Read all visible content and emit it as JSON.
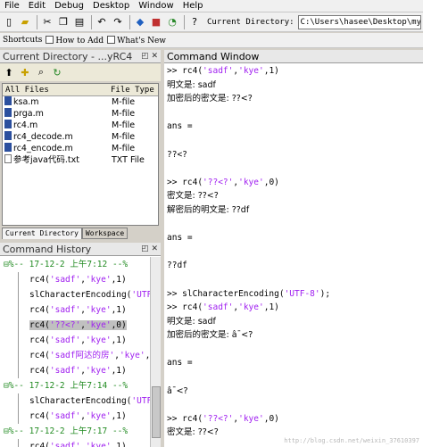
{
  "menu": [
    "File",
    "Edit",
    "Debug",
    "Desktop",
    "Window",
    "Help"
  ],
  "toolbar": {
    "current_directory_label": "Current Directory:",
    "current_directory_value": "C:\\Users\\hasee\\Desktop\\myRC4"
  },
  "shortcuts": {
    "label": "Shortcuts",
    "how_to_add": "How to Add",
    "whats_new": "What's New"
  },
  "current_directory_pane": {
    "title": "Current Directory - ...yRC4",
    "columns": [
      "All Files",
      "File Type"
    ],
    "files": [
      {
        "name": "ksa.m",
        "type": "M-file",
        "icon": "m-file-icon"
      },
      {
        "name": "prga.m",
        "type": "M-file",
        "icon": "m-file-icon"
      },
      {
        "name": "rc4.m",
        "type": "M-file",
        "icon": "m-file-icon"
      },
      {
        "name": "rc4_decode.m",
        "type": "M-file",
        "icon": "m-file-icon"
      },
      {
        "name": "rc4_encode.m",
        "type": "M-file",
        "icon": "m-file-icon"
      },
      {
        "name": "参考java代码.txt",
        "type": "TXT File",
        "icon": "text-file-icon"
      }
    ],
    "tabs": [
      "Current Directory",
      "Workspace"
    ]
  },
  "command_history": {
    "title": "Command History"
  },
  "command_window": {
    "title": "Command Window",
    "lines": [
      ">> rc4('sadf','kye',1)",
      "明文是: sadf",
      "加密后的密文是: ??<?",
      "",
      "ans =",
      "",
      "??<?",
      "",
      ">> rc4('??<?','kye',0)",
      "密文是: ??<?",
      "解密后的明文是: ??df",
      "",
      "ans =",
      "",
      "??df",
      "",
      ">> slCharacterEncoding('UTF-8');",
      ">> rc4('sadf','kye',1)",
      "明文是: sadf",
      "加密后的密文是: â¯<?",
      "",
      "ans =",
      "",
      "â¯<?",
      "",
      ">> rc4('??<?','kye',0)",
      "密文是: ??<?"
    ]
  },
  "watermark": "http://blog.csdn.net/weixin_37610397"
}
